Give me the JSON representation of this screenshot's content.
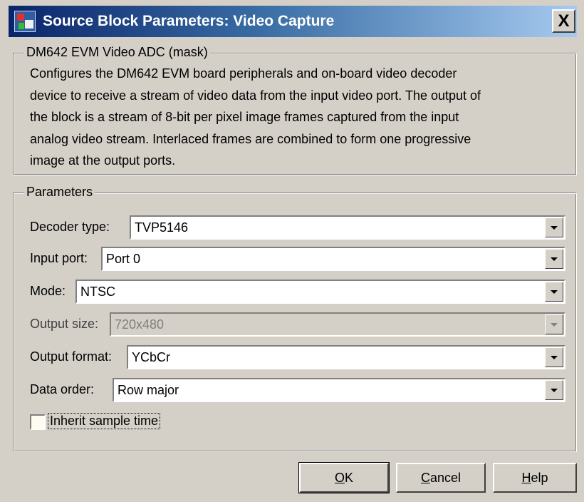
{
  "window": {
    "title": "Source Block Parameters: Video Capture",
    "close_glyph": "X"
  },
  "mask": {
    "legend": "DM642 EVM Video ADC (mask)",
    "description_lines": [
      "Configures the DM642 EVM board peripherals and on-board video decoder",
      "device to receive a stream of video data from the input video port. The output of",
      "the block is a stream of 8-bit per pixel  image frames captured from the input",
      "analog video stream. Interlaced frames are combined to form one progressive",
      "image at the output ports."
    ]
  },
  "parameters": {
    "legend": "Parameters",
    "decoder_type": {
      "label": "Decoder type:",
      "value": "TVP5146"
    },
    "input_port": {
      "label": "Input port:",
      "value": "Port 0"
    },
    "mode": {
      "label": "Mode:",
      "value": "NTSC"
    },
    "output_size": {
      "label": "Output size:",
      "value": "720x480",
      "disabled": true
    },
    "output_format": {
      "label": "Output format:",
      "value": "YCbCr"
    },
    "data_order": {
      "label": "Data order:",
      "value": "Row major"
    },
    "inherit_sample_time": {
      "label": "Inherit sample time",
      "checked": false
    }
  },
  "buttons": {
    "ok": {
      "mnemonic": "O",
      "rest": "K"
    },
    "cancel": {
      "mnemonic": "C",
      "rest": "ancel"
    },
    "help": {
      "mnemonic": "H",
      "rest": "elp"
    }
  },
  "colors": {
    "face": "#d4d0c8",
    "title_start": "#0a246a",
    "title_end": "#a6caf0"
  }
}
